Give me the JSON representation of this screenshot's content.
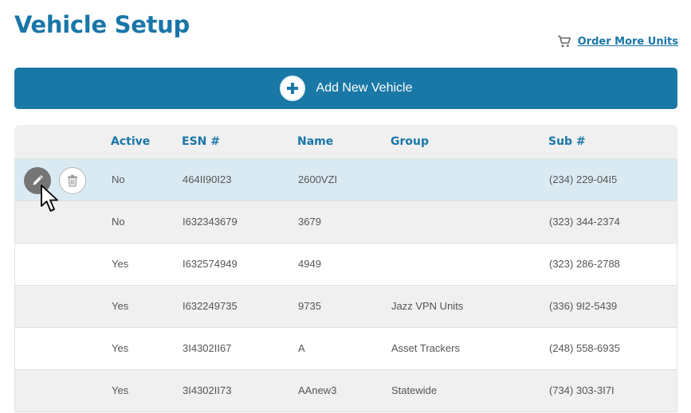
{
  "page": {
    "title": "Vehicle Setup",
    "order_link": "Order More Units",
    "add_button": "Add New Vehicle"
  },
  "colors": {
    "accent": "#1976a8",
    "button": "#1a78a6",
    "row_hover": "#daeaf3",
    "row_alt": "#f0f0f0"
  },
  "table": {
    "headers": {
      "active": "Active",
      "esn": "ESN #",
      "name": "Name",
      "group": "Group",
      "sub": "Sub #"
    },
    "rows": [
      {
        "active": "No",
        "esn": "464II90I23",
        "name": "2600VZI",
        "group": "",
        "sub": "(234) 229-04I5"
      },
      {
        "active": "No",
        "esn": "I632343679",
        "name": "3679",
        "group": "",
        "sub": "(323) 344-2374"
      },
      {
        "active": "Yes",
        "esn": "I632574949",
        "name": "4949",
        "group": "",
        "sub": "(323) 286-2788"
      },
      {
        "active": "Yes",
        "esn": "I632249735",
        "name": "9735",
        "group": "Jazz VPN Units",
        "sub": "(336) 9I2-5439"
      },
      {
        "active": "Yes",
        "esn": "3I4302II67",
        "name": "A",
        "group": "Asset Trackers",
        "sub": "(248) 558-6935"
      },
      {
        "active": "Yes",
        "esn": "3I4302II73",
        "name": "AAnew3",
        "group": "Statewide",
        "sub": "(734) 303-3I7I"
      }
    ]
  },
  "icons": {
    "cart": "cart-icon",
    "plus": "plus-circle-icon",
    "edit": "pencil-icon",
    "delete": "trash-icon",
    "cursor": "mouse-pointer-icon"
  }
}
